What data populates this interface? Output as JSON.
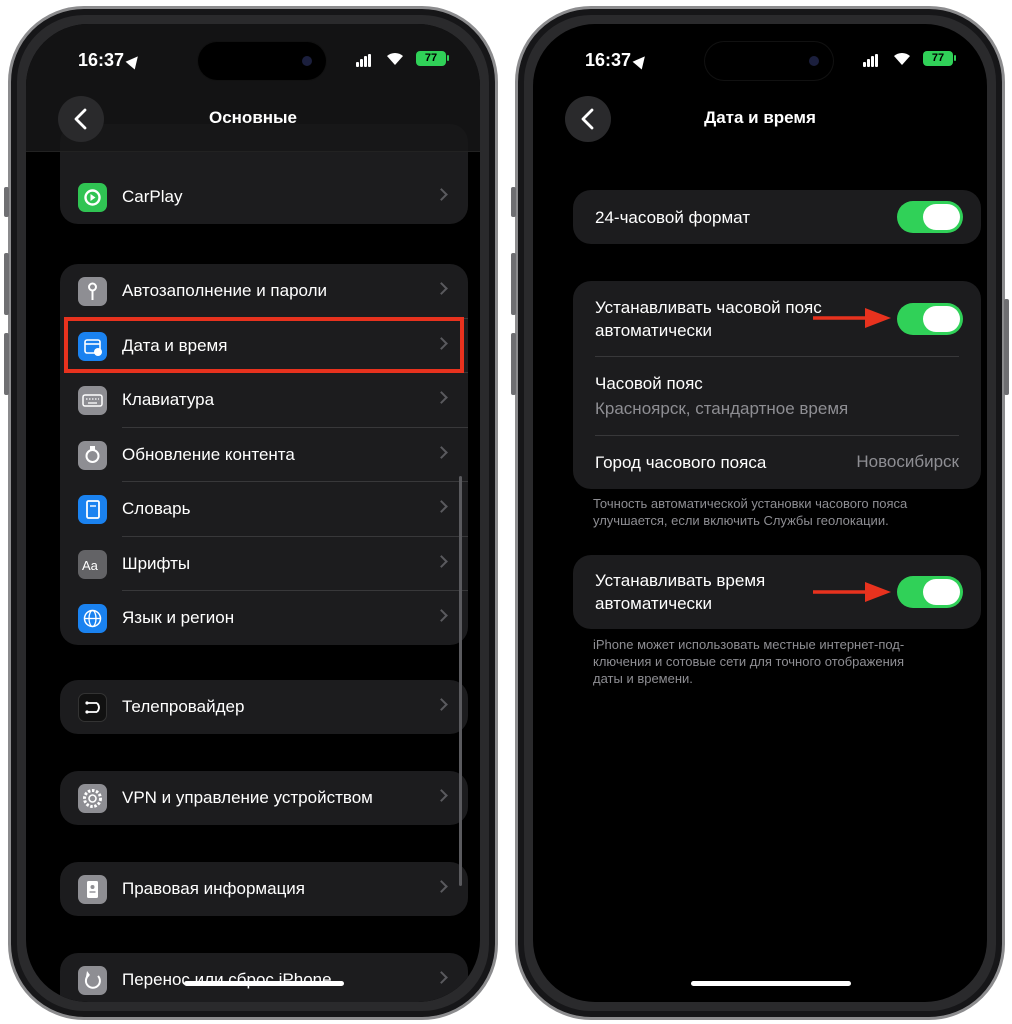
{
  "status_bar": {
    "time": "16:37",
    "battery": "77"
  },
  "left_screen": {
    "nav_title": "Основные",
    "group1": [
      {
        "label": "CarPlay",
        "icon": "carplay-icon",
        "color": "#30c453"
      }
    ],
    "group2": [
      {
        "label": "Автозаполнение и пароли",
        "icon": "key-icon",
        "color": "#8e8e93"
      },
      {
        "label": "Дата и время",
        "icon": "calendar-clock-icon",
        "color": "#1a82f0"
      },
      {
        "label": "Клавиатура",
        "icon": "keyboard-icon",
        "color": "#8e8e93"
      },
      {
        "label": "Обновление контента",
        "icon": "refresh-app-icon",
        "color": "#8e8e93"
      },
      {
        "label": "Словарь",
        "icon": "book-icon",
        "color": "#1a82f0"
      },
      {
        "label": "Шрифты",
        "icon": "fonts-icon",
        "color": "#636366"
      },
      {
        "label": "Язык и регион",
        "icon": "globe-icon",
        "color": "#1a82f0"
      }
    ],
    "group3": [
      {
        "label": "Телепровайдер",
        "icon": "tv-provider-icon",
        "color": "#111111"
      }
    ],
    "group4": [
      {
        "label": "VPN и управление устройством",
        "icon": "gear-icon",
        "color": "#8e8e93"
      }
    ],
    "group5": [
      {
        "label": "Правовая информация",
        "icon": "legal-doc-icon",
        "color": "#8e8e93"
      }
    ],
    "group6": [
      {
        "label": "Перенос или сброс iPhone",
        "icon": "reset-icon",
        "color": "#8e8e93"
      }
    ]
  },
  "right_screen": {
    "nav_title": "Дата и время",
    "format_24h_label": "24-часовой формат",
    "format_24h_on": true,
    "auto_timezone_label_1": "Устанавливать часовой пояс",
    "auto_timezone_label_2": "автоматически",
    "auto_timezone_on": true,
    "timezone_label": "Часовой пояс",
    "timezone_value": "Красноярск, стандартное время",
    "city_label": "Город часового пояса",
    "city_value": "Новосибирск",
    "footnote1_line1": "Точность автоматической установки часового пояса",
    "footnote1_line2": "улучшается, если включить Службы геолокации.",
    "auto_time_label_1": "Устанавливать время",
    "auto_time_label_2": "автоматически",
    "auto_time_on": true,
    "footnote2_line1": "iPhone может использовать местные интернет-под-",
    "footnote2_line2": "ключения и сотовые сети для точного отображения",
    "footnote2_line3": "даты и времени."
  },
  "colors": {
    "accent_green": "#30d158",
    "highlight_red": "#e8321e"
  }
}
